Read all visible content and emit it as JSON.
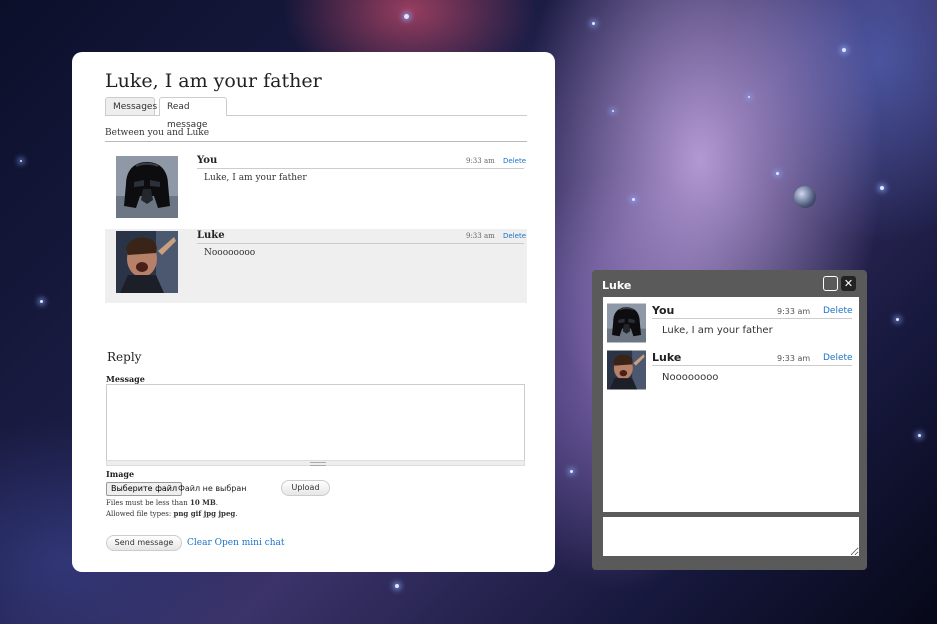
{
  "page": {
    "title": "Luke, I am your father",
    "tabs": [
      {
        "label": "Messages"
      },
      {
        "label": "Read message"
      }
    ],
    "between_text": "Between you and Luke"
  },
  "thread": {
    "messages": [
      {
        "author": "You",
        "time": "9:33 am",
        "delete_label": "Delete",
        "text": "Luke, I am your father",
        "avatar_icon": "vader-avatar"
      },
      {
        "author": "Luke",
        "time": "9:33 am",
        "delete_label": "Delete",
        "text": "Noooooooo",
        "avatar_icon": "luke-avatar"
      }
    ]
  },
  "reply": {
    "title": "Reply",
    "message_label": "Message",
    "message_value": "",
    "image_label": "Image",
    "file_button_label": "Выберите файл",
    "file_status": "Файл не выбран",
    "upload_label": "Upload",
    "hint_size_prefix": "Files must be less than ",
    "hint_size_value": "10 MB",
    "hint_size_suffix": ".",
    "hint_types_prefix": "Allowed file types: ",
    "hint_types_value": "png gif jpg jpeg",
    "hint_types_suffix": ".",
    "send_label": "Send message",
    "clear_label": "Clear Open mini chat"
  },
  "mini_chat": {
    "title": "Luke",
    "close_glyph": "✕",
    "messages": [
      {
        "author": "You",
        "time": "9:33 am",
        "delete_label": "Delete",
        "text": "Luke, I am your father"
      },
      {
        "author": "Luke",
        "time": "9:33 am",
        "delete_label": "Delete",
        "text": "Noooooooo"
      }
    ],
    "input_value": ""
  },
  "colors": {
    "link": "#1a73c8",
    "panel_bg": "#ffffff",
    "mini_chat_frame": "#5a5a5a"
  }
}
